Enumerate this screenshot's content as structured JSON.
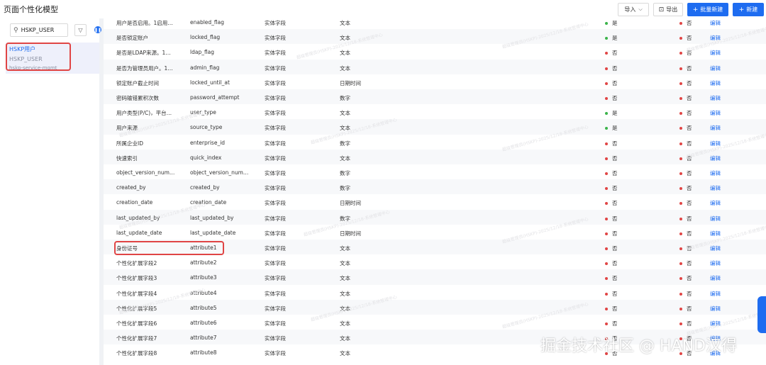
{
  "page_title": "页面个性化模型",
  "toolbar": {
    "import_label": "导入",
    "export_label": "导出",
    "batch_new_label": "批量新建",
    "new_label": "新建"
  },
  "sidebar": {
    "search_value": "HSKP_USER",
    "model": {
      "name": "HSKP用户",
      "code": "HSKP_USER",
      "service": "hskp-service-mgmt"
    }
  },
  "status_colors": {
    "yes": "#3bb34a",
    "no": "#e04545"
  },
  "edit_label": "编辑",
  "watermark": "超级管理员(HSKP)-2025/12/18-系统管理中心",
  "brand_mark": "掘金技术社区 @ HAND汉得",
  "rows": [
    {
      "name": "用户是否启用。1启用…",
      "code": "enabled_flag",
      "field_type": "实体字段",
      "data_type": "文本",
      "flag1": "是",
      "flag1_on": true,
      "flag2": "否"
    },
    {
      "name": "是否锁定账户",
      "code": "locked_flag",
      "field_type": "实体字段",
      "data_type": "文本",
      "flag1": "是",
      "flag1_on": true,
      "flag2": "否"
    },
    {
      "name": "是否是LDAP来源。1…",
      "code": "ldap_flag",
      "field_type": "实体字段",
      "data_type": "文本",
      "flag1": "否",
      "flag1_on": false,
      "flag2": "否"
    },
    {
      "name": "是否为管理员用户。1…",
      "code": "admin_flag",
      "field_type": "实体字段",
      "data_type": "文本",
      "flag1": "否",
      "flag1_on": false,
      "flag2": "否"
    },
    {
      "name": "锁定账户截止时间",
      "code": "locked_until_at",
      "field_type": "实体字段",
      "data_type": "日期时间",
      "flag1": "否",
      "flag1_on": false,
      "flag2": "否"
    },
    {
      "name": "密码输错累积次数",
      "code": "password_attempt",
      "field_type": "实体字段",
      "data_type": "数字",
      "flag1": "否",
      "flag1_on": false,
      "flag2": "否"
    },
    {
      "name": "用户类型(P/C)，平台…",
      "code": "user_type",
      "field_type": "实体字段",
      "data_type": "文本",
      "flag1": "是",
      "flag1_on": true,
      "flag2": "否"
    },
    {
      "name": "用户来源",
      "code": "source_type",
      "field_type": "实体字段",
      "data_type": "文本",
      "flag1": "是",
      "flag1_on": true,
      "flag2": "否"
    },
    {
      "name": "所属企业ID",
      "code": "enterprise_id",
      "field_type": "实体字段",
      "data_type": "数字",
      "flag1": "否",
      "flag1_on": false,
      "flag2": "否"
    },
    {
      "name": "快速索引",
      "code": "quick_index",
      "field_type": "实体字段",
      "data_type": "文本",
      "flag1": "否",
      "flag1_on": false,
      "flag2": "否"
    },
    {
      "name": "object_version_num…",
      "code": "object_version_num…",
      "field_type": "实体字段",
      "data_type": "数字",
      "flag1": "否",
      "flag1_on": false,
      "flag2": "否"
    },
    {
      "name": "created_by",
      "code": "created_by",
      "field_type": "实体字段",
      "data_type": "数字",
      "flag1": "否",
      "flag1_on": false,
      "flag2": "否"
    },
    {
      "name": "creation_date",
      "code": "creation_date",
      "field_type": "实体字段",
      "data_type": "日期时间",
      "flag1": "否",
      "flag1_on": false,
      "flag2": "否"
    },
    {
      "name": "last_updated_by",
      "code": "last_updated_by",
      "field_type": "实体字段",
      "data_type": "数字",
      "flag1": "否",
      "flag1_on": false,
      "flag2": "否"
    },
    {
      "name": "last_update_date",
      "code": "last_update_date",
      "field_type": "实体字段",
      "data_type": "日期时间",
      "flag1": "否",
      "flag1_on": false,
      "flag2": "否"
    },
    {
      "name": "身份证号",
      "code": "attribute1",
      "field_type": "实体字段",
      "data_type": "文本",
      "flag1": "否",
      "flag1_on": false,
      "flag2": "否"
    },
    {
      "name": "个性化扩展字段2",
      "code": "attribute2",
      "field_type": "实体字段",
      "data_type": "文本",
      "flag1": "否",
      "flag1_on": false,
      "flag2": "否"
    },
    {
      "name": "个性化扩展字段3",
      "code": "attribute3",
      "field_type": "实体字段",
      "data_type": "文本",
      "flag1": "否",
      "flag1_on": false,
      "flag2": "否"
    },
    {
      "name": "个性化扩展字段4",
      "code": "attribute4",
      "field_type": "实体字段",
      "data_type": "文本",
      "flag1": "否",
      "flag1_on": false,
      "flag2": "否"
    },
    {
      "name": "个性化扩展字段5",
      "code": "attribute5",
      "field_type": "实体字段",
      "data_type": "文本",
      "flag1": "否",
      "flag1_on": false,
      "flag2": "否"
    },
    {
      "name": "个性化扩展字段6",
      "code": "attribute6",
      "field_type": "实体字段",
      "data_type": "文本",
      "flag1": "否",
      "flag1_on": false,
      "flag2": "否"
    },
    {
      "name": "个性化扩展字段7",
      "code": "attribute7",
      "field_type": "实体字段",
      "data_type": "文本",
      "flag1": "否",
      "flag1_on": false,
      "flag2": "否"
    },
    {
      "name": "个性化扩展字段8",
      "code": "attribute8",
      "field_type": "实体字段",
      "data_type": "文本",
      "flag1": "否",
      "flag1_on": false,
      "flag2": "否"
    }
  ]
}
